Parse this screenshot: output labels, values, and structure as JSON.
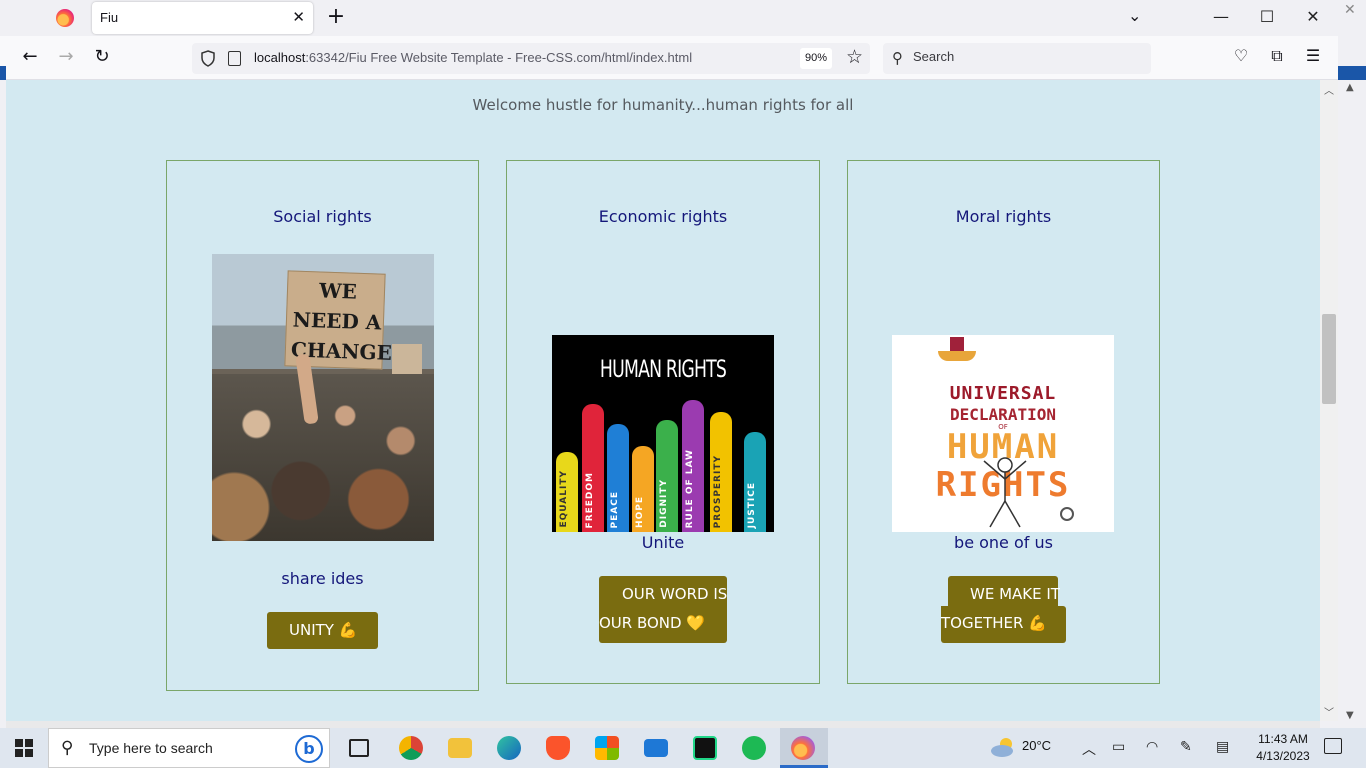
{
  "browser": {
    "tab_title": "Fiu",
    "tab_close": "✕",
    "new_tab": "+",
    "url_host": "localhost",
    "url_rest": ":63342/Fiu Free Website Template - Free-CSS.com/html/index.html",
    "zoom": "90%",
    "search_placeholder": "Search"
  },
  "page": {
    "welcome": "Welcome hustle for humanity...human rights for all",
    "cards": [
      {
        "title": "Social rights",
        "image_sign_text": "WE NEED A CHANGE",
        "subtitle": "share ides",
        "button": "UNITY 💪"
      },
      {
        "title": "Economic rights",
        "image_title": "HUMAN RIGHTS",
        "image_words": [
          "EQUALITY",
          "FREEDOM",
          "PEACE",
          "HOPE",
          "DIGNITY",
          "RULE OF LAW",
          "PROSPERITY",
          "JUSTICE"
        ],
        "subtitle": "Unite",
        "button_line1": "OUR WORD IS",
        "button_line2": "OUR BOND 💛"
      },
      {
        "title": "Moral rights",
        "image_line1": "UNIVERSAL",
        "image_line2": "DECLARATION",
        "image_line3": "OF",
        "image_line4": "HUMAN",
        "image_line5": "RIGHTS",
        "subtitle": "be one of us",
        "button_line1": "WE MAKE IT",
        "button_line2": "TOGETHER 💪"
      }
    ]
  },
  "taskbar": {
    "search_placeholder": "Type here to search",
    "temperature": "20°C",
    "time": "11:43 AM",
    "date": "4/13/2023"
  },
  "colors": {
    "page_bg": "#d3e9f1",
    "heading": "#14177a",
    "button_bg": "#7a6c10",
    "card_border": "#7aa66a"
  }
}
